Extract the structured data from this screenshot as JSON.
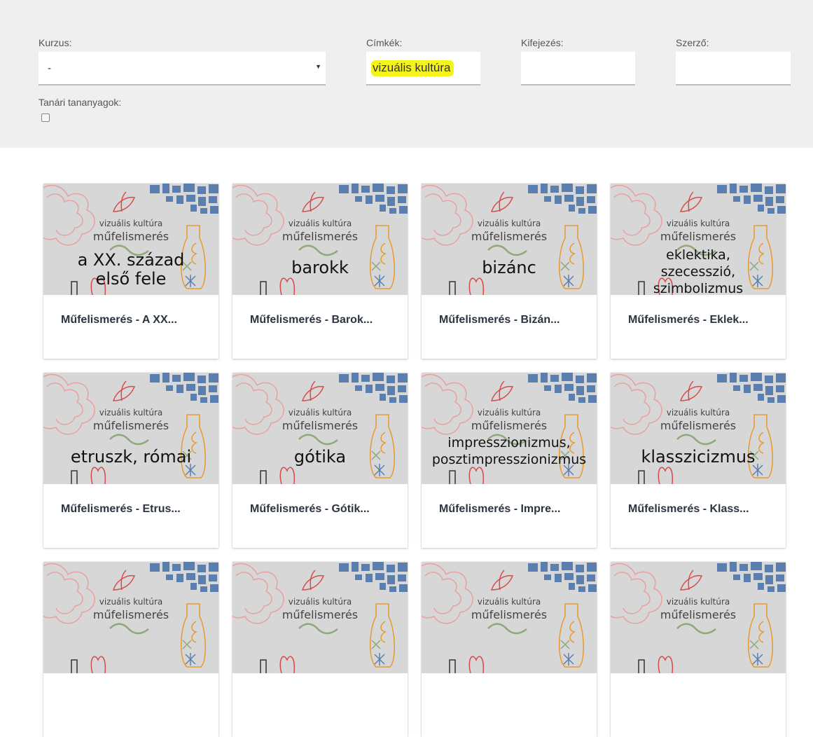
{
  "filters": {
    "kurzus": {
      "label": "Kurzus:",
      "value": "-"
    },
    "cimkek": {
      "label": "Címkék:",
      "value": "vizuális kultúra"
    },
    "kifejezes": {
      "label": "Kifejezés:",
      "value": ""
    },
    "szerzo": {
      "label": "Szerző:",
      "value": ""
    },
    "tanari": {
      "label": "Tanári tananyagok:",
      "checked": false
    }
  },
  "cards": [
    {
      "overline": "vizuális kultúra",
      "subtitle": "műfelismerés",
      "topic": "a XX. század\nelső fele",
      "title": "Műfelismerés - A XX..."
    },
    {
      "overline": "vizuális kultúra",
      "subtitle": "műfelismerés",
      "topic": "barokk",
      "title": "Műfelismerés - Barok..."
    },
    {
      "overline": "vizuális kultúra",
      "subtitle": "műfelismerés",
      "topic": "bizánc",
      "title": "Műfelismerés - Bizán..."
    },
    {
      "overline": "vizuális kultúra",
      "subtitle": "műfelismerés",
      "topic": "eklektika,\nszecesszió,\nszimbolizmus",
      "title": "Műfelismerés - Eklek..."
    },
    {
      "overline": "vizuális kultúra",
      "subtitle": "műfelismerés",
      "topic": "etruszk, római",
      "title": "Műfelismerés - Etrus..."
    },
    {
      "overline": "vizuális kultúra",
      "subtitle": "műfelismerés",
      "topic": "gótika",
      "title": "Műfelismerés - Gótik..."
    },
    {
      "overline": "vizuális kultúra",
      "subtitle": "műfelismerés",
      "topic": "impresszionizmus,\nposztimpresszionizmus",
      "title": "Műfelismerés - Impre..."
    },
    {
      "overline": "vizuális kultúra",
      "subtitle": "műfelismerés",
      "topic": "klasszicizmus",
      "title": "Műfelismerés - Klass..."
    },
    {
      "overline": "vizuális kultúra",
      "subtitle": "műfelismerés",
      "topic": "",
      "title": ""
    },
    {
      "overline": "vizuális kultúra",
      "subtitle": "műfelismerés",
      "topic": "",
      "title": ""
    },
    {
      "overline": "vizuális kultúra",
      "subtitle": "műfelismerés",
      "topic": "",
      "title": ""
    },
    {
      "overline": "vizuális kultúra",
      "subtitle": "műfelismerés",
      "topic": "",
      "title": ""
    }
  ],
  "colors": {
    "filter_bg": "#efefef",
    "tag_highlight": "#f4f41a",
    "thumb_bg": "#d7d7d7",
    "blue_shapes": "#5a7fae",
    "pink_lines": "#e8a0a0",
    "red_lines": "#d94a4a",
    "orange_lines": "#e89a2e",
    "green_lines": "#8fa87a",
    "card_title": "#2c3440"
  }
}
